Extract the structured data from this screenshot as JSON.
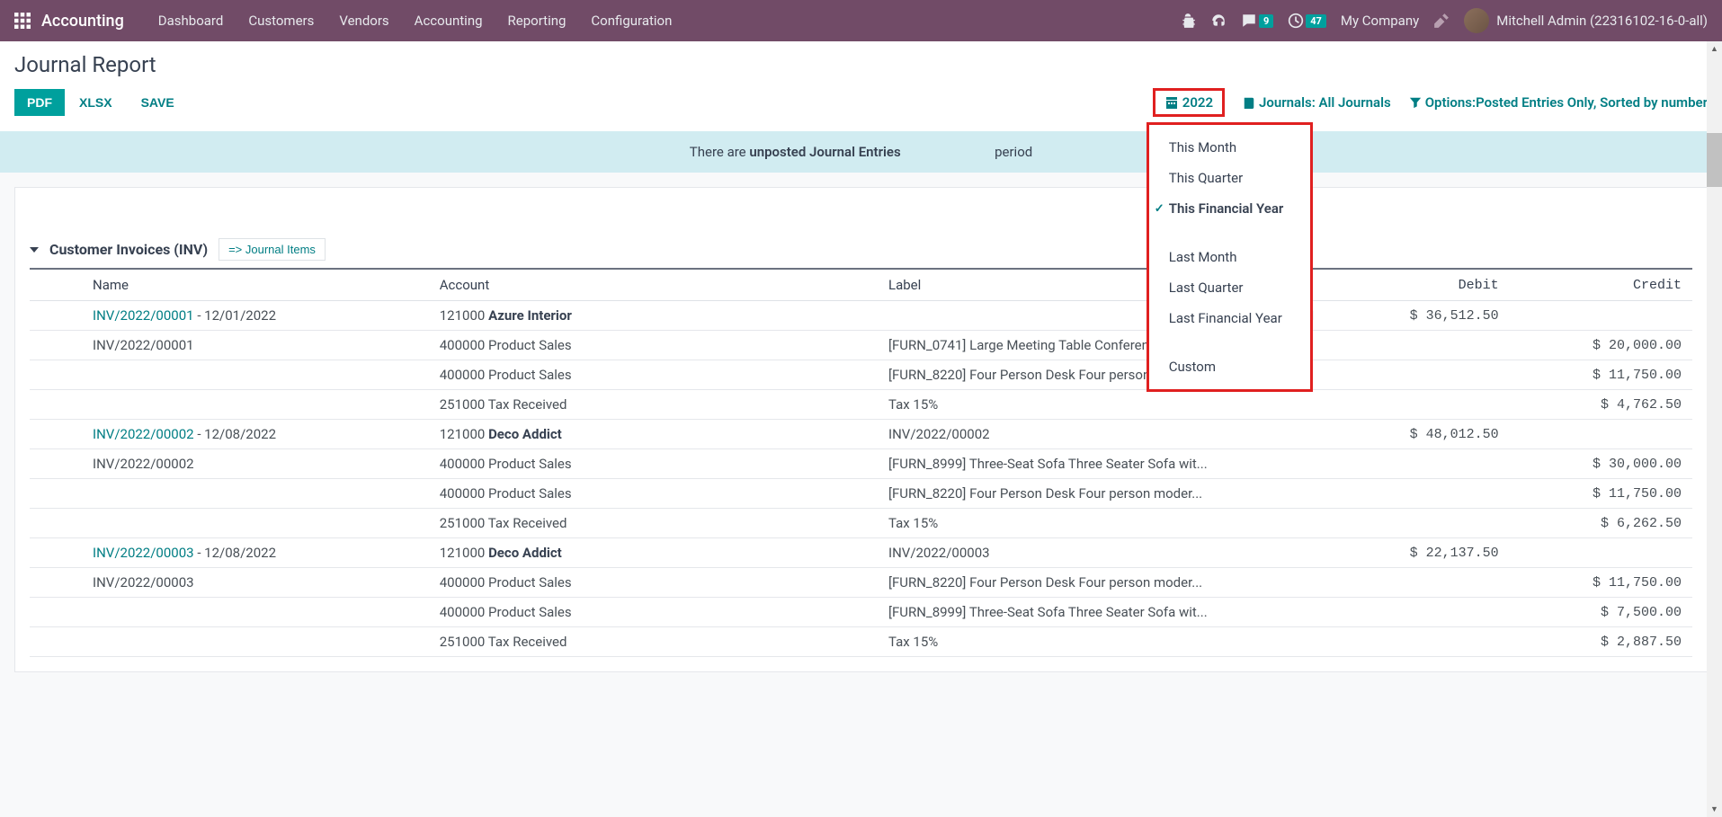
{
  "nav": {
    "app_name": "Accounting",
    "items": [
      "Dashboard",
      "Customers",
      "Vendors",
      "Accounting",
      "Reporting",
      "Configuration"
    ],
    "messages_badge": "9",
    "activities_badge": "47",
    "company": "My Company",
    "user": "Mitchell Admin (22316102-16-0-all)"
  },
  "page": {
    "title": "Journal Report",
    "btn_pdf": "PDF",
    "btn_xlsx": "XLSX",
    "btn_save": "SAVE"
  },
  "filters": {
    "date_value": "2022",
    "journals_label": "Journals: All Journals",
    "options_label": "Options:Posted Entries Only, Sorted by number"
  },
  "date_dropdown": {
    "items": [
      {
        "label": "This Month",
        "selected": false
      },
      {
        "label": "This Quarter",
        "selected": false
      },
      {
        "label": "This Financial Year",
        "selected": true
      },
      {
        "label": "Last Month",
        "selected": false,
        "gap_before": true
      },
      {
        "label": "Last Quarter",
        "selected": false
      },
      {
        "label": "Last Financial Year",
        "selected": false
      },
      {
        "label": "Custom",
        "selected": false,
        "gap_before": true
      }
    ]
  },
  "alert": {
    "prefix": "There are ",
    "strong": "unposted Journal Entries",
    "suffix": " period"
  },
  "section": {
    "title": "Customer Invoices (INV)",
    "journal_items": "=> Journal Items"
  },
  "table": {
    "headers": {
      "name": "Name",
      "account": "Account",
      "label": "Label",
      "debit": "Debit",
      "credit": "Credit"
    },
    "rows": [
      {
        "name_link": "INV/2022/00001",
        "name_suffix": " - 12/01/2022",
        "account_code": "121000 ",
        "account_bold": "Azure Interior",
        "label_hidden_by_dropdown": "1",
        "debit": "$ 36,512.50",
        "credit": ""
      },
      {
        "name_text": "INV/2022/00001",
        "account_plain": "400000 Product Sales",
        "label": "[FURN_0741] Large Meeting Table Conference roo...",
        "debit": "",
        "credit": "$ 20,000.00"
      },
      {
        "name_text": "",
        "account_plain": "400000 Product Sales",
        "label": "[FURN_8220] Four Person Desk Four person moder...",
        "debit": "",
        "credit": "$ 11,750.00"
      },
      {
        "name_text": "",
        "account_plain": "251000 Tax Received",
        "label": "Tax 15%",
        "debit": "",
        "credit": "$ 4,762.50"
      },
      {
        "name_link": "INV/2022/00002",
        "name_suffix": " - 12/08/2022",
        "account_code": "121000 ",
        "account_bold": "Deco Addict",
        "label": "INV/2022/00002",
        "debit": "$ 48,012.50",
        "credit": ""
      },
      {
        "name_text": "INV/2022/00002",
        "account_plain": "400000 Product Sales",
        "label": "[FURN_8999] Three-Seat Sofa Three Seater Sofa wit...",
        "debit": "",
        "credit": "$ 30,000.00"
      },
      {
        "name_text": "",
        "account_plain": "400000 Product Sales",
        "label": "[FURN_8220] Four Person Desk Four person moder...",
        "debit": "",
        "credit": "$ 11,750.00"
      },
      {
        "name_text": "",
        "account_plain": "251000 Tax Received",
        "label": "Tax 15%",
        "debit": "",
        "credit": "$ 6,262.50"
      },
      {
        "name_link": "INV/2022/00003",
        "name_suffix": " - 12/08/2022",
        "account_code": "121000 ",
        "account_bold": "Deco Addict",
        "label": "INV/2022/00003",
        "debit": "$ 22,137.50",
        "credit": ""
      },
      {
        "name_text": "INV/2022/00003",
        "account_plain": "400000 Product Sales",
        "label": "[FURN_8220] Four Person Desk Four person moder...",
        "debit": "",
        "credit": "$ 11,750.00"
      },
      {
        "name_text": "",
        "account_plain": "400000 Product Sales",
        "label": "[FURN_8999] Three-Seat Sofa Three Seater Sofa wit...",
        "debit": "",
        "credit": "$ 7,500.00"
      },
      {
        "name_text": "",
        "account_plain": "251000 Tax Received",
        "label": "Tax 15%",
        "debit": "",
        "credit": "$ 2,887.50"
      }
    ]
  }
}
